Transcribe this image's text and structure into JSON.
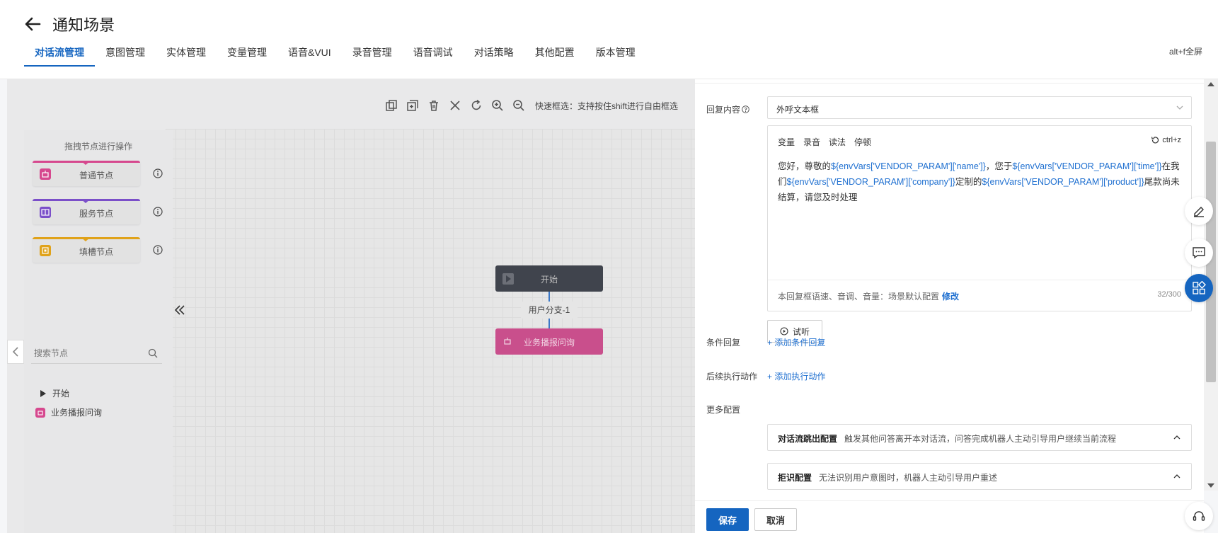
{
  "header": {
    "title": "通知场景",
    "tabs": [
      {
        "label": "对话流管理"
      },
      {
        "label": "意图管理"
      },
      {
        "label": "实体管理"
      },
      {
        "label": "变量管理"
      },
      {
        "label": "语音&VUI"
      },
      {
        "label": "录音管理"
      },
      {
        "label": "语音调试"
      },
      {
        "label": "对话策略"
      },
      {
        "label": "其他配置"
      },
      {
        "label": "版本管理"
      }
    ],
    "fullscreen_hint": "alt+f全屏"
  },
  "canvas": {
    "toolbar_hint": "快速框选：支持按住shift进行自由框选",
    "start_node": "开始",
    "branch_label": "用户分支-1",
    "biz_node": "业务播报问询"
  },
  "left_panel": {
    "title": "拖拽节点进行操作",
    "nodes": [
      {
        "label": "普通节点",
        "color": "#d6488e"
      },
      {
        "label": "服务节点",
        "color": "#7b4fc9"
      },
      {
        "label": "填槽节点",
        "color": "#e0a21a"
      }
    ],
    "search_placeholder": "搜索节点",
    "tree": [
      {
        "label": "开始"
      },
      {
        "label": "业务播报问询"
      }
    ]
  },
  "drawer": {
    "reply_label": "回复内容",
    "reply_type": "外呼文本框",
    "editor_tools": [
      "变量",
      "录音",
      "读法",
      "停顿"
    ],
    "undo_hint": "ctrl+z",
    "text": {
      "p1": "您好，尊敬的",
      "v1": "${envVars['VENDOR_PARAM']['name']}",
      "p2": "，您于",
      "v2": "${envVars['VENDOR_PARAM']['time']}",
      "p3": "在我们",
      "v3": "${envVars['VENDOR_PARAM']['company']}",
      "p4": "定制的",
      "v4": "${envVars['VENDOR_PARAM']['product']}",
      "p5": "尾款尚未结算，请您及时处理"
    },
    "footer_info": "本回复框语速、音调、音量：场景默认配置",
    "footer_edit": "修改",
    "char_count": "32/300",
    "listen_label": "试听",
    "cond_label": "条件回复",
    "cond_link": "+ 添加条件回复",
    "action_label": "后续执行动作",
    "action_link": "+ 添加执行动作",
    "more_label": "更多配置",
    "configs": [
      {
        "title": "对话流跳出配置",
        "desc": "触发其他问答离开本对话流，问答完成机器人主动引导用户继续当前流程"
      },
      {
        "title": "拒识配置",
        "desc": "无法识别用户意图时，机器人主动引导用户重述"
      }
    ],
    "save_label": "保存",
    "cancel_label": "取消"
  },
  "colors": {
    "accent": "#1565c0",
    "link": "#1e6fd0",
    "biz_node": "#c94f8c",
    "start_node": "#40444d"
  }
}
